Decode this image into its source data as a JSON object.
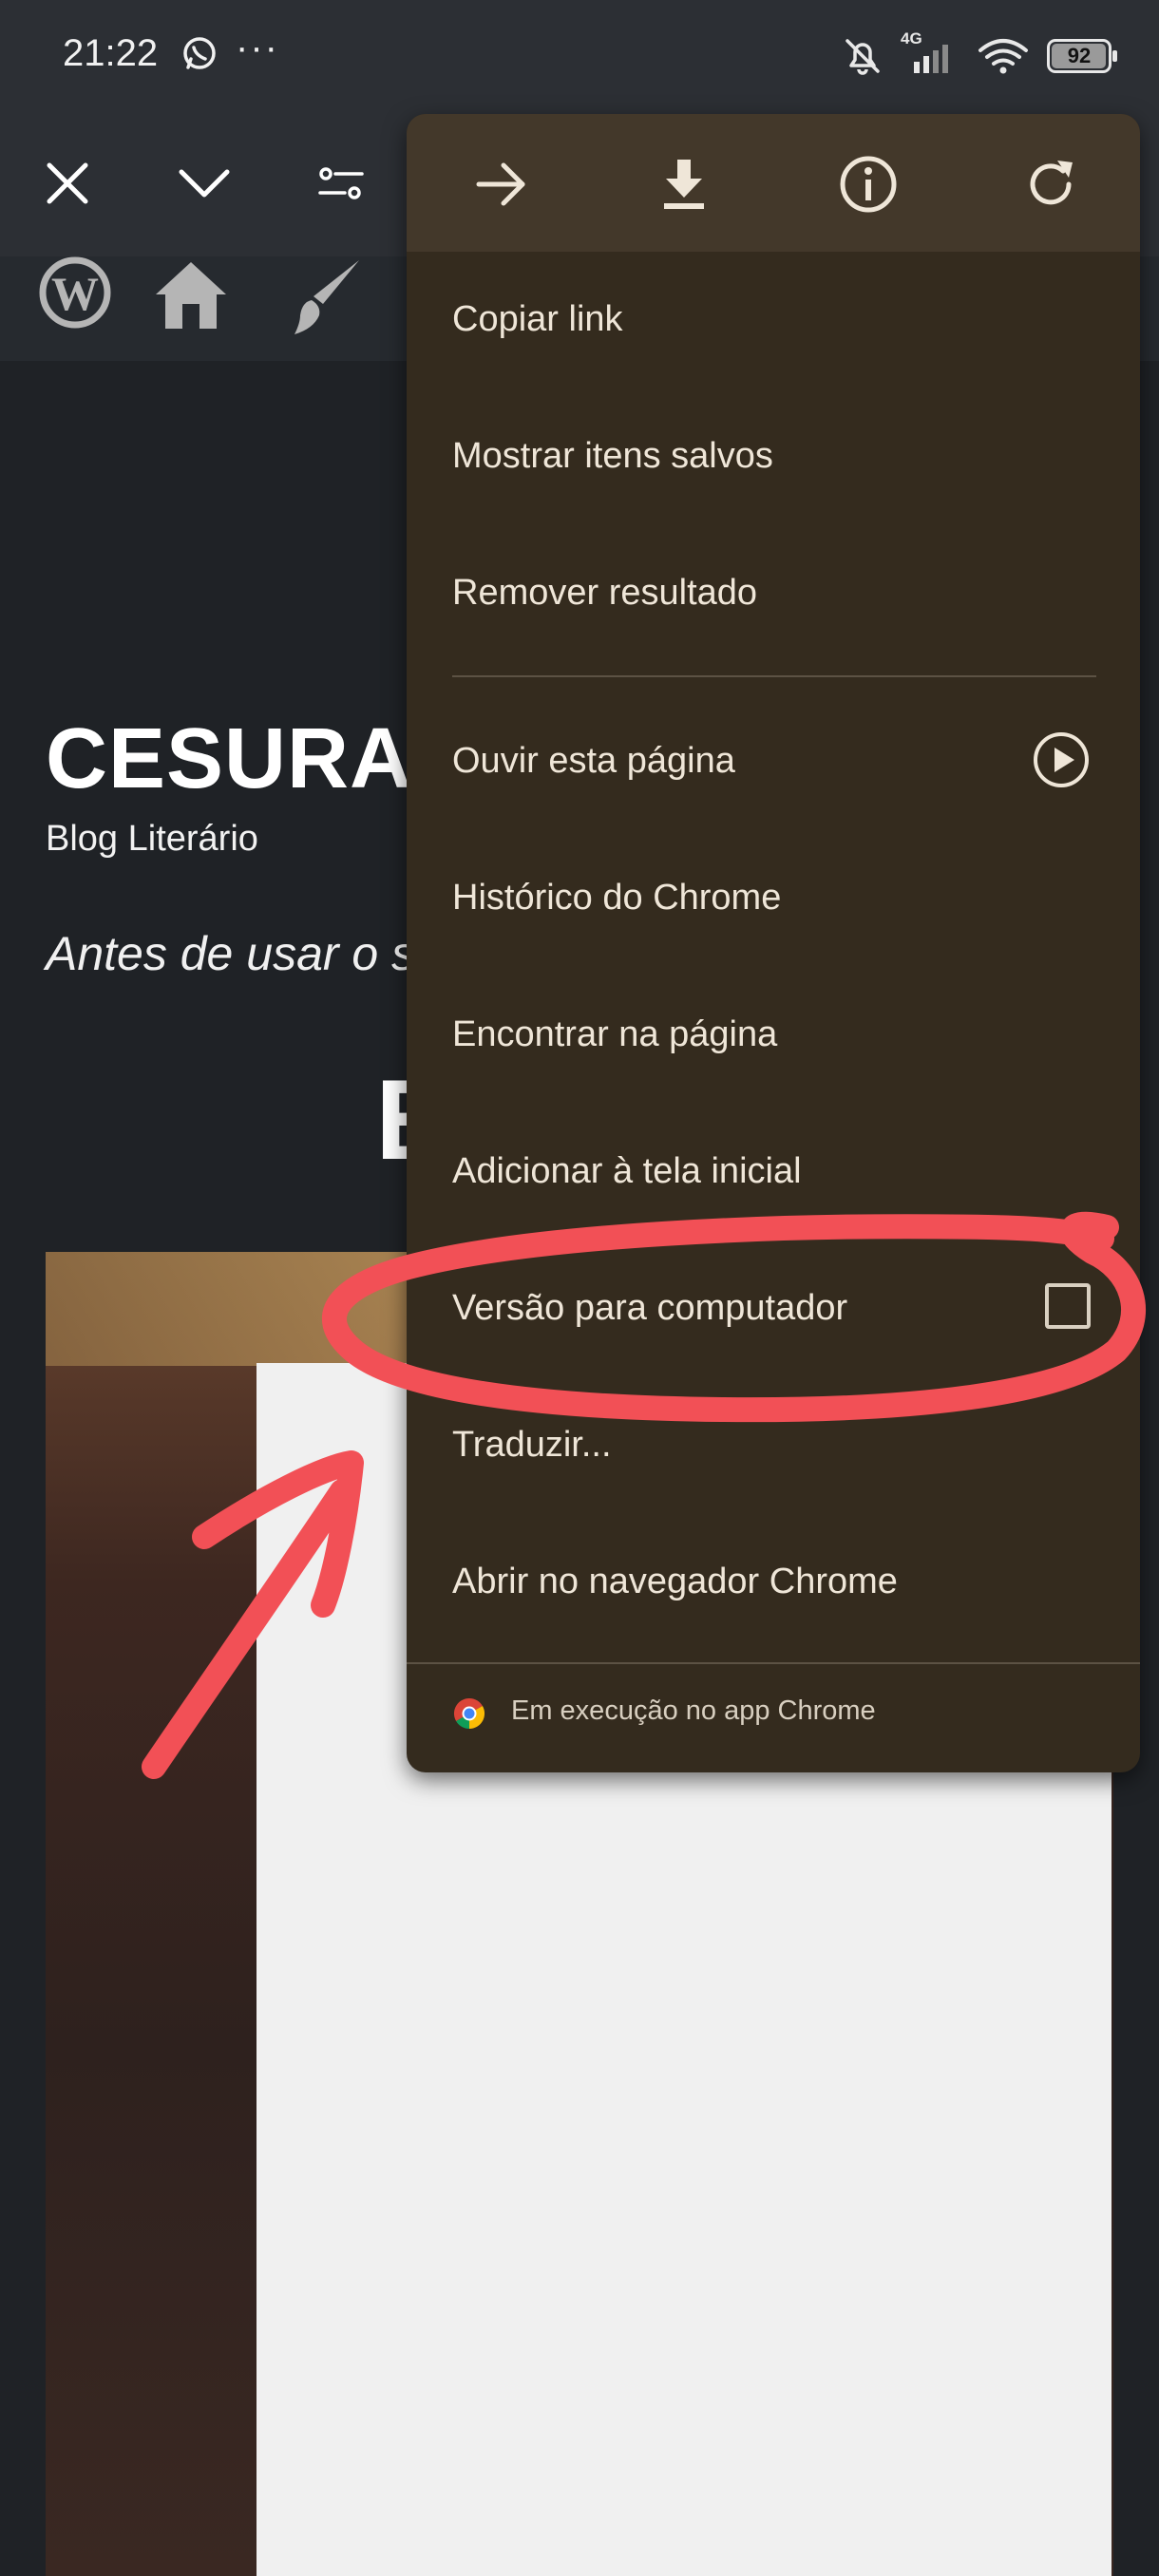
{
  "status_bar": {
    "time": "21:22",
    "more_dots": "···",
    "network": "4G",
    "battery": "92",
    "battery_level": 0.92
  },
  "toolbar": {
    "close_icon": "close-icon",
    "collapse_icon": "chevron-down-icon",
    "settings_icon": "tune-icon"
  },
  "page": {
    "site_title": "CESURAS",
    "site_subtitle": "Blog Literário",
    "italic_line": "Antes de usar o s",
    "big_letter": "E"
  },
  "menu": {
    "top_icons": [
      "forward-arrow-icon",
      "download-icon",
      "info-icon",
      "refresh-icon"
    ],
    "items": [
      {
        "label": "Copiar link"
      },
      {
        "label": "Mostrar itens salvos"
      },
      {
        "label": "Remover resultado"
      },
      {
        "label": "Ouvir esta página"
      },
      {
        "label": "Histórico do Chrome"
      },
      {
        "label": "Encontrar na página"
      },
      {
        "label": "Adicionar à tela inicial"
      },
      {
        "label": "Versão para computador",
        "checked": false
      },
      {
        "label": "Traduzir..."
      },
      {
        "label": "Abrir no navegador Chrome"
      }
    ],
    "footer": "Em execução no app Chrome"
  },
  "colors": {
    "menu_bg": "#342b1e",
    "menu_header_bg": "#43382a",
    "annotation": "#f25056",
    "status_bg": "#2c2f34"
  }
}
